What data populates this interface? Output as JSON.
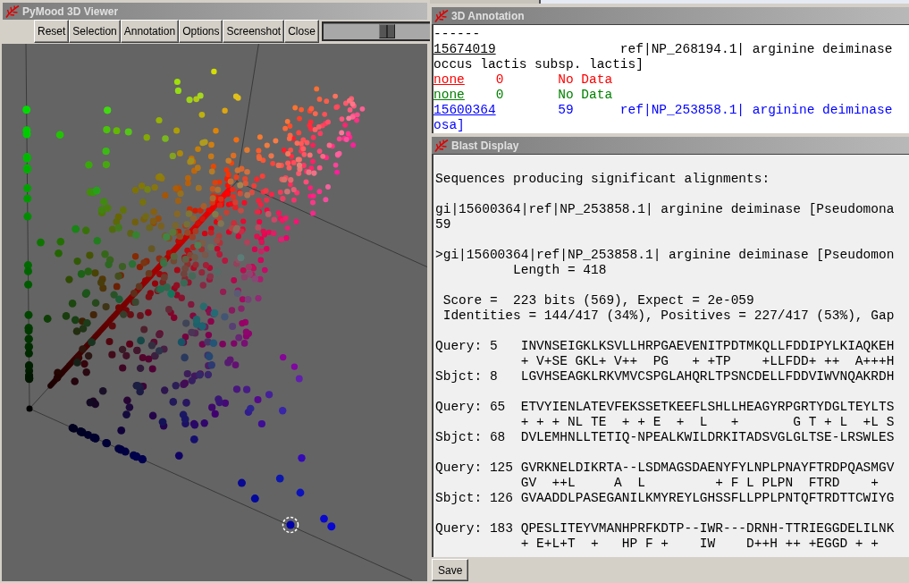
{
  "viewer": {
    "title": "PyMood 3D Viewer",
    "buttons": [
      "Reset",
      "Selection",
      "Annotation",
      "Options",
      "Screenshot",
      "Close"
    ],
    "slider": {
      "level": 0.6
    }
  },
  "annotation": {
    "title": "3D Annotation",
    "rule": "------",
    "entries": [
      {
        "id": "15674019",
        "description": "ref|NP_268194.1| arginine deiminase",
        "continuation": "occus lactis subsp. lactis]",
        "color": "#000000"
      },
      {
        "id": "none",
        "score": "0",
        "description": "No Data",
        "color": "#ff0000"
      },
      {
        "id": "none",
        "score": "0",
        "description": "No Data",
        "color": "#008000"
      },
      {
        "id": "15600364",
        "score": "59",
        "description": "ref|NP_253858.1| arginine deiminase",
        "continuation": "osa]",
        "color": "#0000ff"
      }
    ]
  },
  "blast": {
    "title": "Blast Display",
    "heading": "Sequences producing significant alignments:",
    "hit": {
      "description": "gi|15600364|ref|NP_253858.1| arginine deiminase [Pseudomona",
      "score": "59"
    },
    "alignment": {
      "definition": ">gi|15600364|ref|NP_253858.1| arginine deiminase [Pseudomon",
      "length": "Length = 418",
      "score": "Score =  223 bits (569), Expect = 2e-059",
      "identities": "Identities = 144/417 (34%), Positives = 227/417 (53%), Gap"
    },
    "blocks": [
      {
        "query": "Query: 5   INVNSEIGKLKSVLLHRPGAEVENITPDTMKQLLFDDIPYLKIAQKEH",
        "match": "+ V+SE GKL+ V++  PG   + +TP    +LLFDD+ ++  A+++H",
        "subject": "Sbjct: 8   LGVHSEAGKLRKVMVCSPGLAHQRLTPSNCDELLFDDVIWVNQAKRDH"
      },
      {
        "query": "Query: 65  ETVYIENLATEVFEKSSETKEEFLSHLLHEAGYRPGRTYDGLTEYLTS",
        "match": "+ + + NL TE  + + E  +  L   +       G T + L  +L S",
        "subject": "Sbjct: 68  DVLEMHNLLTETIQ-NPEALKWILDRKITADSVGLGLTSE-LRSWLES"
      },
      {
        "query": "Query: 125 GVRKNELDIKRTA--LSDMAGSDAENYFYLNPLPNAYFTRDPQASMGV",
        "match": "GV  ++L     A  L         + F L PLPN  FTRD    +",
        "subject": "Sbjct: 126 GVAADDLPASEGANILKMYREYLGHSSFLLPPLPNTQFTRDTTCWIYG"
      },
      {
        "query": "Query: 183 QPESLITEYVMANHPRFKDTP--IWR---DRNH-TTRIEGGDELILNK",
        "match": "+ E+L+T  +   HP F +    IW    D++H ++ +EGGD + +"
      }
    ],
    "buttons": [
      "Save"
    ]
  }
}
